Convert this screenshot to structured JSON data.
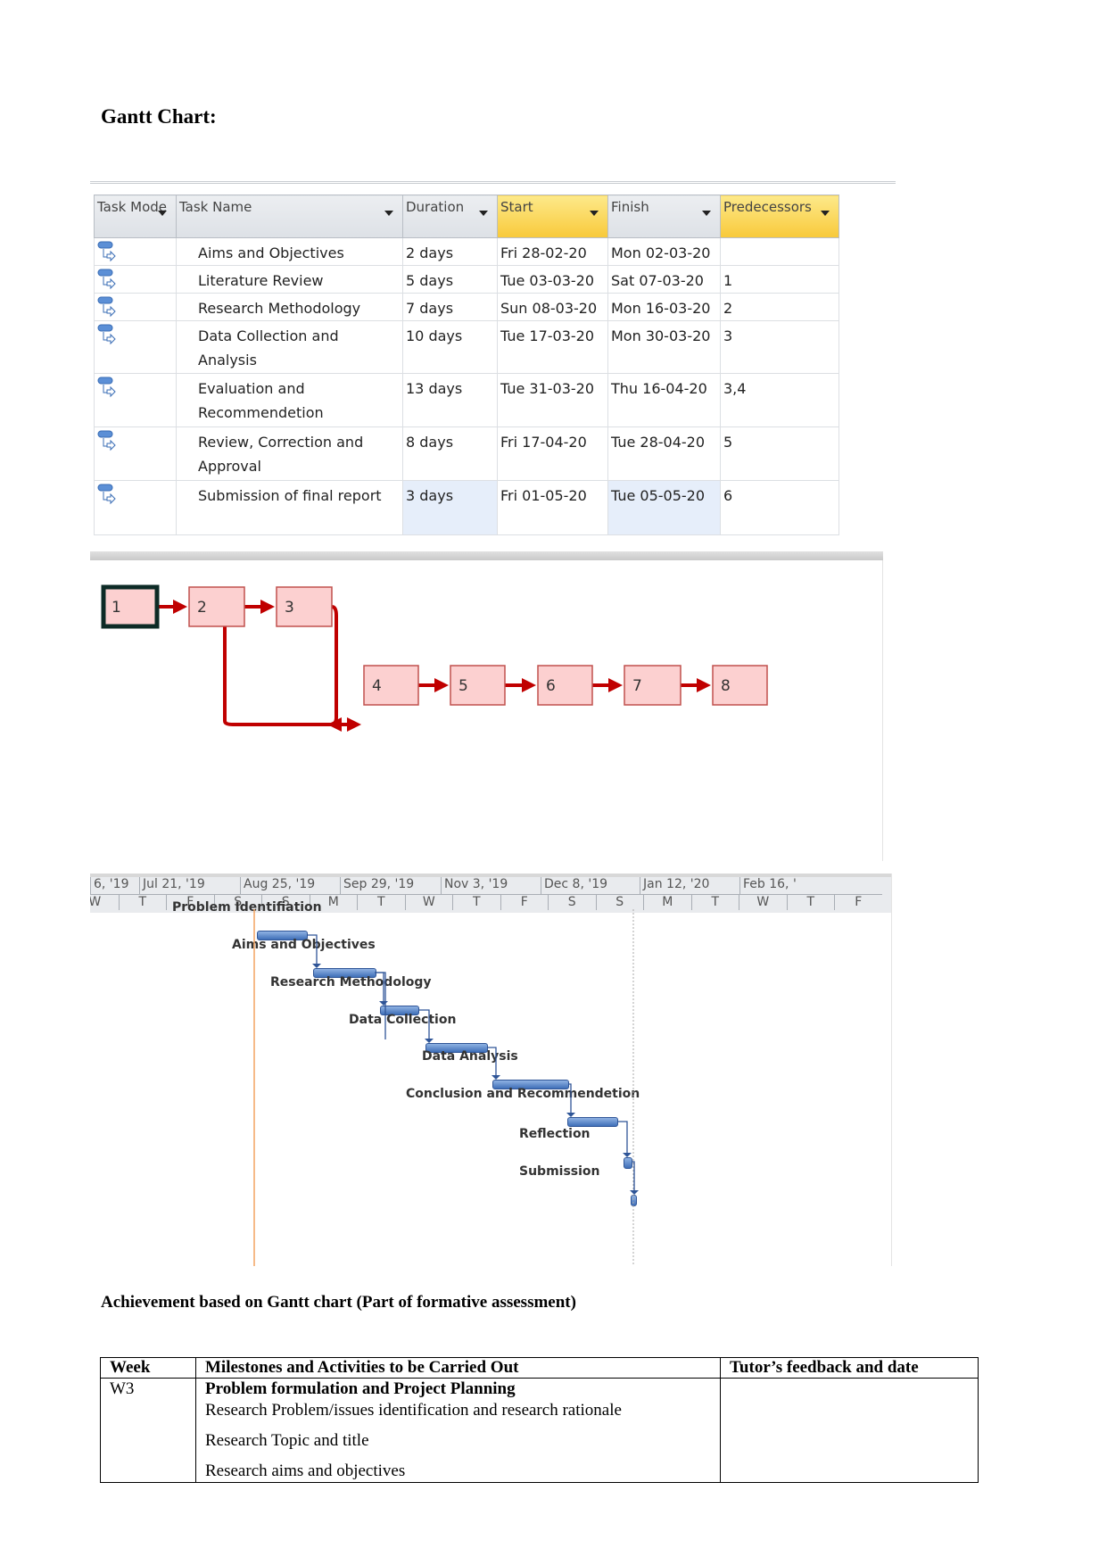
{
  "title": "Gantt Chart:",
  "project_table": {
    "columns": [
      "Task Mode",
      "Task Name",
      "Duration",
      "Start",
      "Finish",
      "Predecessors"
    ],
    "highlighted_columns": [
      "Start",
      "Predecessors"
    ],
    "rows": [
      {
        "name": "Aims and Objectives",
        "duration": "2 days",
        "start": "Fri 28-02-20",
        "finish": "Mon 02-03-20",
        "pred": ""
      },
      {
        "name": "Literature Review",
        "duration": "5 days",
        "start": "Tue 03-03-20",
        "finish": "Sat 07-03-20",
        "pred": "1"
      },
      {
        "name": "Research Methodology",
        "duration": "7 days",
        "start": "Sun 08-03-20",
        "finish": "Mon 16-03-20",
        "pred": "2"
      },
      {
        "name": "Data Collection and Analysis",
        "duration": "10 days",
        "start": "Tue 17-03-20",
        "finish": "Mon 30-03-20",
        "pred": "3"
      },
      {
        "name": "Evaluation and Recommendetion",
        "duration": "13 days",
        "start": "Tue 31-03-20",
        "finish": "Thu 16-04-20",
        "pred": "3,4"
      },
      {
        "name": "Review, Correction and Approval",
        "duration": "8 days",
        "start": "Fri 17-04-20",
        "finish": "Tue 28-04-20",
        "pred": "5"
      },
      {
        "name": "Submission of final report",
        "duration": "3 days",
        "start": "Fri 01-05-20",
        "finish": "Tue 05-05-20",
        "pred": "6"
      }
    ],
    "colors": {
      "header": "#dfe3e8",
      "highlight": "#f9cf45",
      "selected": "#e6eefa"
    }
  },
  "network": {
    "nodes": [
      "1",
      "2",
      "3",
      "4",
      "5",
      "6",
      "7",
      "8"
    ],
    "links": [
      [
        "1",
        "2"
      ],
      [
        "2",
        "3"
      ],
      [
        "2",
        "4"
      ],
      [
        "3",
        "4"
      ],
      [
        "4",
        "5"
      ],
      [
        "5",
        "6"
      ],
      [
        "6",
        "7"
      ],
      [
        "7",
        "8"
      ]
    ],
    "colors": {
      "node_fill": "#fcd0d0",
      "node_border": "#c0504d",
      "link": "#c00000"
    }
  },
  "timeline": {
    "periods": [
      "6, '19",
      "Jul 21, '19",
      "Aug 25, '19",
      "Sep 29, '19",
      "Nov 3, '19",
      "Dec 8, '19",
      "Jan 12, '20",
      "Feb 16, '"
    ],
    "days": [
      "W",
      "T",
      "F",
      "S",
      "S",
      "M",
      "T",
      "W",
      "T",
      "F",
      "S",
      "S",
      "M",
      "T",
      "W",
      "T",
      "F"
    ],
    "tasks": [
      "Problem Identifiation",
      "Aims and Objectives",
      "Research Methodology",
      "Data Collection",
      "Data Analysis",
      "Conclusion and Recommendetion",
      "Reflection",
      "Submission"
    ],
    "colors": {
      "bar": "#4f81bd",
      "today_line": "#f4a460"
    }
  },
  "achievement": {
    "title": "Achievement based on Gantt chart (Part of formative assessment)",
    "headers": [
      "Week",
      "Milestones and Activities to be Carried Out",
      "Tutor’s feedback and date"
    ],
    "rows": [
      {
        "week": "W3",
        "milestone": "Problem formulation and Project Planning",
        "activities": [
          "Research Problem/issues identification and research rationale",
          "Research Topic and title",
          "Research aims and objectives"
        ],
        "feedback": ""
      }
    ]
  }
}
